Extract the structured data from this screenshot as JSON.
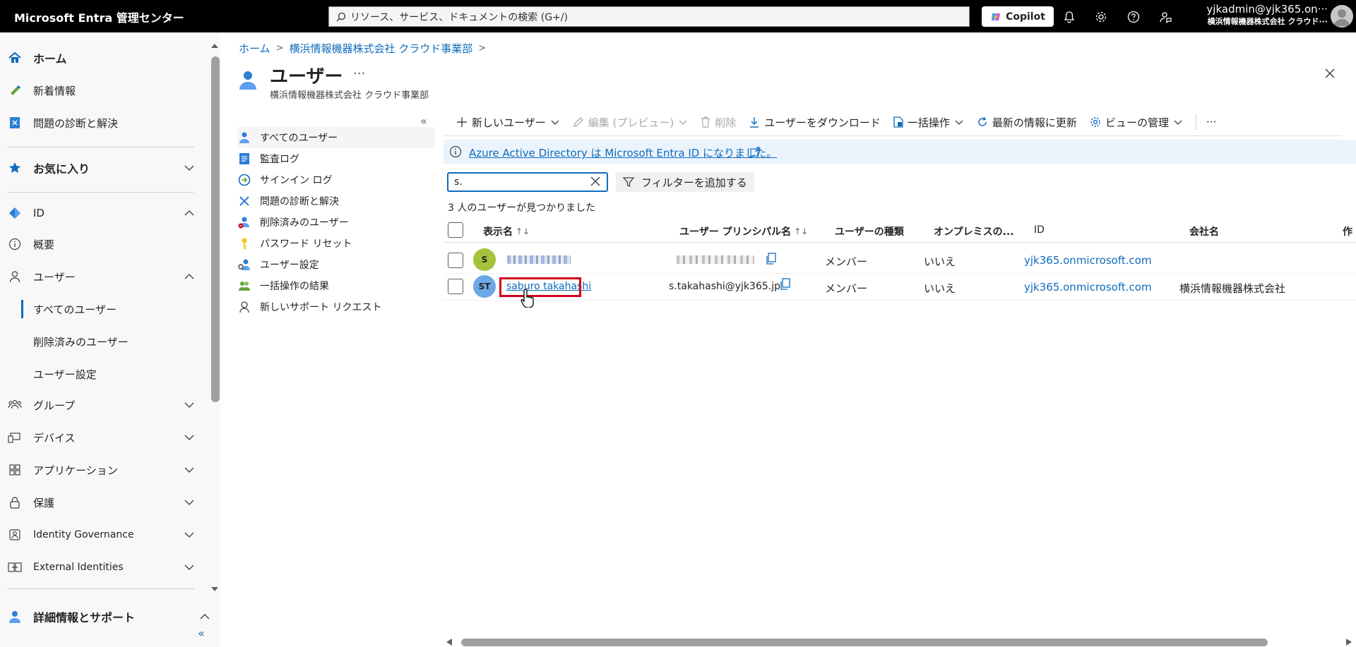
{
  "topbar": {
    "brand": "Microsoft Entra 管理センター",
    "search_placeholder": "リソース、サービス、ドキュメントの検索 (G+/)",
    "copilot": "Copilot",
    "account_email": "yjkadmin@yjk365.on···",
    "account_org": "横浜情報機器株式会社 クラウド···"
  },
  "sidebar": {
    "home": "ホーム",
    "whats_new": "新着情報",
    "diagnose": "問題の診断と解決",
    "favorites": "お気に入り",
    "identity": "ID",
    "overview": "概要",
    "users": "ユーザー",
    "all_users": "すべてのユーザー",
    "deleted_users": "削除済みのユーザー",
    "user_settings": "ユーザー設定",
    "groups": "グループ",
    "devices": "デバイス",
    "applications": "アプリケーション",
    "protection": "保護",
    "identity_governance": "Identity Governance",
    "external_identities": "External Identities",
    "learn_support": "詳細情報とサポート",
    "collapse": "«"
  },
  "breadcrumb": {
    "home": "ホーム",
    "org": "横浜情報機器株式会社 クラウド事業部"
  },
  "page": {
    "title": "ユーザー",
    "more": "···",
    "subtitle": "横浜情報機器株式会社 クラウド事業部"
  },
  "left_menu": {
    "collapse": "«",
    "items": [
      "すべてのユーザー",
      "監査ログ",
      "サインイン ログ",
      "問題の診断と解決",
      "削除済みのユーザー",
      "パスワード リセット",
      "ユーザー設定",
      "一括操作の結果",
      "新しいサポート リクエスト"
    ]
  },
  "toolbar": {
    "new_user": "新しいユーザー",
    "edit": "編集 (プレビュー)",
    "delete": "削除",
    "download": "ユーザーをダウンロード",
    "bulk": "一括操作",
    "refresh": "最新の情報に更新",
    "manage_view": "ビューの管理",
    "more": "···"
  },
  "info_banner": {
    "text": "Azure Active Directory は Microsoft Entra ID になりました。"
  },
  "search": {
    "value": "s.",
    "add_filter": "フィルターを追加する",
    "result_count": "3 人のユーザーが見つかりました"
  },
  "table": {
    "headers": {
      "display_name": "表示名",
      "upn": "ユーザー プリンシパル名",
      "user_type": "ユーザーの種類",
      "onprem": "オンプレミスの...",
      "id": "ID",
      "company": "会社名",
      "created": "作"
    },
    "sort_glyph": "↑↓",
    "rows": [
      {
        "initials": "S",
        "avatar_color": "#a4c33a",
        "display_name": "",
        "upn": "",
        "user_type": "メンバー",
        "onprem": "いいえ",
        "id": "yjk365.onmicrosoft.com",
        "company": ""
      },
      {
        "initials": "ST",
        "avatar_color": "#6aa8e6",
        "display_name": "saburo takahashi",
        "upn": "s.takahashi@yjk365.jp",
        "user_type": "メンバー",
        "onprem": "いいえ",
        "id": "yjk365.onmicrosoft.com",
        "company": "横浜情報機器株式会社"
      }
    ]
  },
  "colors": {
    "accent": "#0f6cbd",
    "highlight": "#d0021b"
  }
}
